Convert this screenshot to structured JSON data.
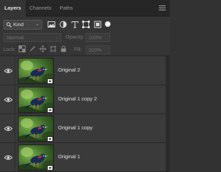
{
  "tabs": [
    {
      "label": "Layers",
      "active": true
    },
    {
      "label": "Channels",
      "active": false
    },
    {
      "label": "Paths",
      "active": false
    }
  ],
  "filter": {
    "kind_label": "Kind",
    "icons": [
      "image-filter-icon",
      "adjustment-filter-icon",
      "type-filter-icon",
      "shape-filter-icon",
      "smart-object-filter-icon"
    ]
  },
  "blend": {
    "mode": "Normal",
    "opacity_label": "Opacity:",
    "opacity_value": "100%"
  },
  "lock": {
    "label": "Lock:",
    "fill_label": "Fill:",
    "fill_value": "100%"
  },
  "layers": [
    {
      "name": "Original 2"
    },
    {
      "name": "Original 1 copy 2"
    },
    {
      "name": "Original 1 copy"
    },
    {
      "name": "Original 1"
    }
  ],
  "colors": {
    "panel": "#353535",
    "row": "#3a3a3a",
    "tabbar": "#262626"
  }
}
